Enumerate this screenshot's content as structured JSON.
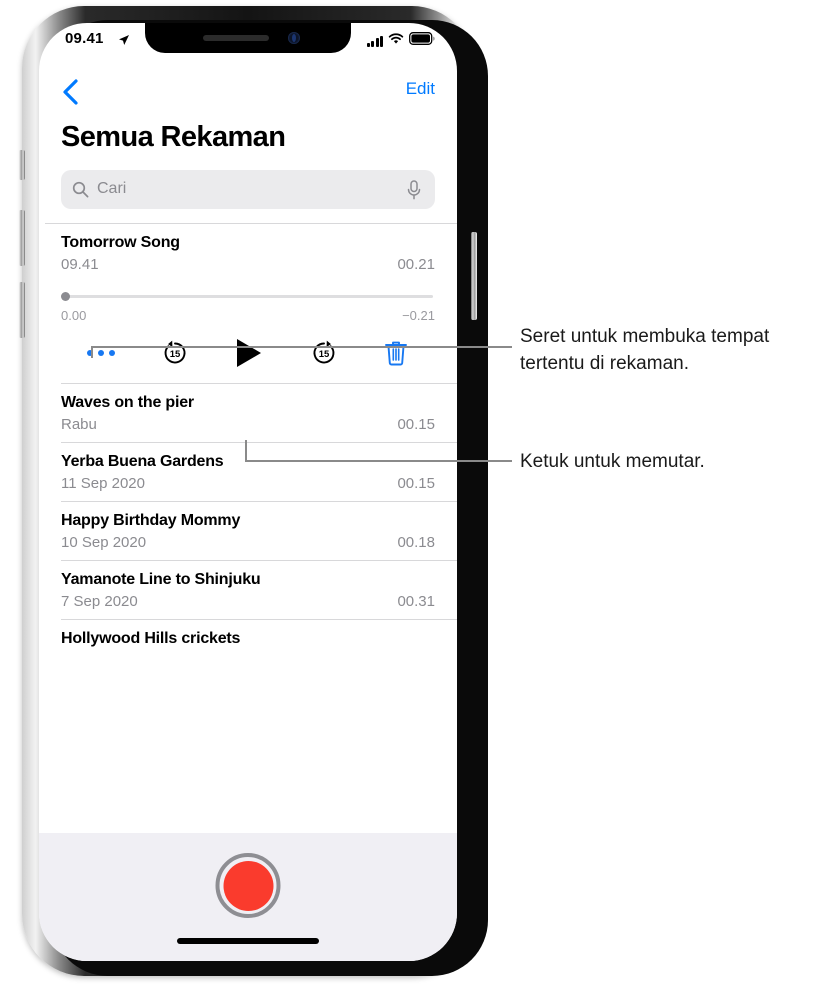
{
  "status_bar": {
    "time": "09.41",
    "location_icon": "location-arrow-icon",
    "signal_icon": "cellular-signal-icon",
    "wifi_icon": "wifi-icon",
    "battery_icon": "battery-full-icon"
  },
  "nav": {
    "back_icon": "chevron-left-icon",
    "edit_label": "Edit"
  },
  "page": {
    "title": "Semua Rekaman"
  },
  "search": {
    "placeholder": "Cari",
    "value": "",
    "search_icon": "search-icon",
    "mic_icon": "microphone-icon"
  },
  "player": {
    "title": "Tomorrow Song",
    "date": "09.41",
    "duration": "00.21",
    "elapsed_label": "0.00",
    "remaining_label": "−0.21",
    "progress_percent": 0,
    "controls": {
      "more_label": "more-options",
      "skip_back_label": "15",
      "play_label": "play",
      "skip_forward_label": "15",
      "delete_label": "delete"
    }
  },
  "recordings": [
    {
      "title": "Waves on the pier",
      "date": "Rabu",
      "duration": "00.15"
    },
    {
      "title": "Yerba Buena Gardens",
      "date": "11 Sep 2020",
      "duration": "00.15"
    },
    {
      "title": "Happy Birthday Mommy",
      "date": "10 Sep 2020",
      "duration": "00.18"
    },
    {
      "title": "Yamanote Line to Shinjuku",
      "date": "7 Sep 2020",
      "duration": "00.31"
    },
    {
      "title": "Hollywood Hills crickets",
      "date": "",
      "duration": ""
    }
  ],
  "toolbar": {
    "record_label": "record-button"
  },
  "callouts": [
    {
      "text": "Seret untuk membuka tempat tertentu di rekaman."
    },
    {
      "text": "Ketuk untuk memutar."
    }
  ],
  "colors": {
    "accent_blue": "#007AFF",
    "control_blue": "#1778f2",
    "record_red": "#FA3B2D",
    "secondary_text": "#8b8b90",
    "toolbar_bg": "#f0eff4"
  }
}
